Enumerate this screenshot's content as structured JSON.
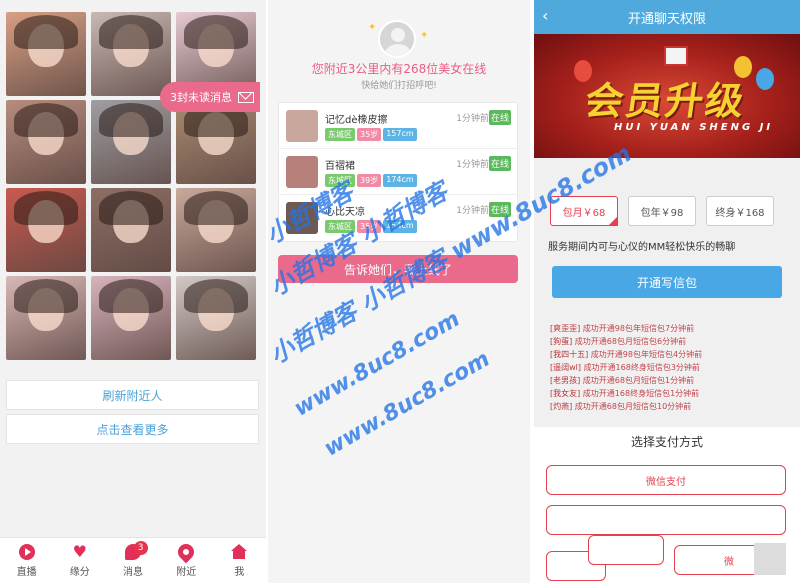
{
  "left": {
    "unread_text": "3封未读消息",
    "refresh_label": "刷新附近人",
    "more_label": "点击查看更多",
    "photo_colors": [
      "#d7a085",
      "#c9b8b3",
      "#e6c9d2",
      "#b68c7e",
      "#9f9ea3",
      "#a98b72",
      "#c85a4f",
      "#8c6f64",
      "#c9a99b",
      "#d9b8b6",
      "#d8b4be",
      "#d2c9c6"
    ],
    "tabs": [
      {
        "label": "直播",
        "icon": "play-icon"
      },
      {
        "label": "缘分",
        "icon": "heart-icon"
      },
      {
        "label": "消息",
        "icon": "message-icon",
        "badge": "3"
      },
      {
        "label": "附近",
        "icon": "location-icon"
      },
      {
        "label": "我",
        "icon": "home-icon"
      }
    ]
  },
  "middle": {
    "title": "您附近3公里内有268位美女在线",
    "subtitle": "快给她们打招呼吧!",
    "users": [
      {
        "name": "记忆dè橡皮擦",
        "time": "1分钟前",
        "status": "在线",
        "loc": "东城区",
        "age": "35岁",
        "height": "157cm"
      },
      {
        "name": "百褶裙",
        "time": "1分钟前",
        "status": "在线",
        "loc": "东城区",
        "age": "39岁",
        "height": "174cm"
      },
      {
        "name": "心比天凉",
        "time": "1分钟前",
        "status": "在线",
        "loc": "东城区",
        "age": "35岁",
        "height": "154cm"
      }
    ],
    "greet_label": "告诉她们，我上线了"
  },
  "right": {
    "nav_title": "开通聊天权限",
    "banner_title": "会员升级",
    "banner_sub": "HUI YUAN SHENG JI",
    "plans": [
      {
        "label": "包月￥68",
        "selected": true
      },
      {
        "label": "包年￥98",
        "selected": false
      },
      {
        "label": "终身￥168",
        "selected": false
      }
    ],
    "service_text": "服务期间内可与心仪的MM轻松快乐的畅聊",
    "open_label": "开通写信包",
    "logs": [
      {
        "user": "[爽歪歪]",
        "text": "成功开通98包年短信包7分钟前"
      },
      {
        "user": "[狗蛋]",
        "text": "成功开通68包月短信包6分钟前"
      },
      {
        "user": "[我四十五]",
        "text": "成功开通98包年短信包4分钟前"
      },
      {
        "user": "[遥阔wl]",
        "text": "成功开通168终身短信包3分钟前"
      },
      {
        "user": "[老男孩]",
        "text": "成功开通68包月短信包1分钟前"
      },
      {
        "user": "[我女友]",
        "text": "成功开通168终身短信包1分钟前"
      },
      {
        "user": "[灼燕]",
        "text": "成功开通68包月短信包10分钟前"
      }
    ],
    "sheet_title": "选择支付方式",
    "pay_wechat": "微信支付",
    "pay_partial": "微"
  },
  "watermark": {
    "line1": "小哲博客",
    "line2": "小哲博客 小哲博客",
    "line3": "小哲博客 小哲博客 www.8uc8.com",
    "line4": "www.8uc8.com",
    "line5": "www.8uc8.com"
  }
}
